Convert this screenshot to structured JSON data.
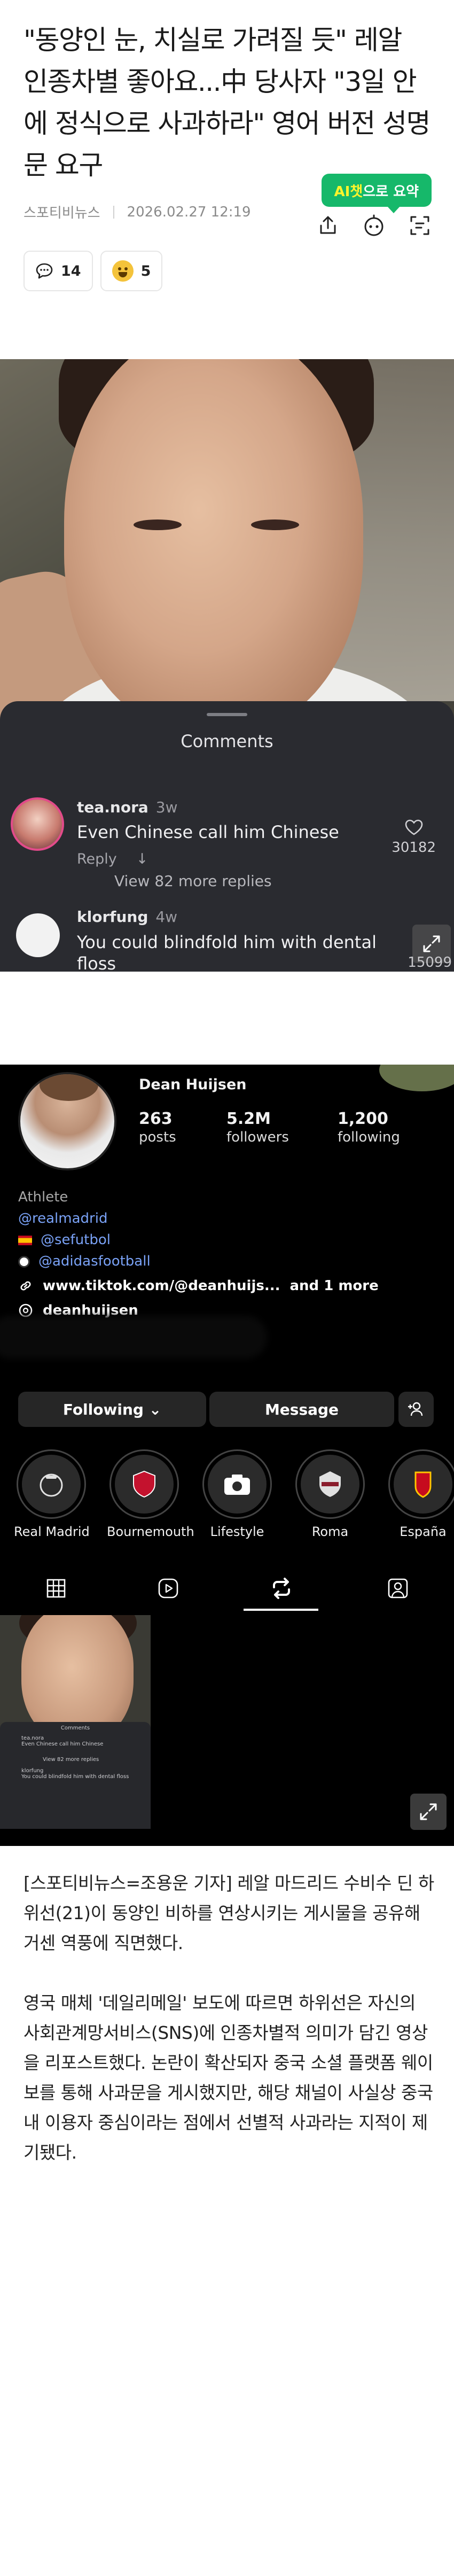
{
  "article": {
    "title": "\"동양인 눈, 치실로 가려질 듯\" 레알 인종차별 좋아요...中 당사자 \"3일 안에 정식으로 사과하라\" 영어 버전 성명문 요구",
    "source": "스포티비뉴스",
    "date": "2026.02.27 12:19",
    "comment_count": "14",
    "reaction_count": "5",
    "ai_summary_prefix": "AI챗",
    "ai_summary_suffix": "으로 요약",
    "paragraphs": [
      "[스포티비뉴스=조용운 기자] 레알 마드리드 수비수 딘 하위선(21)이 동양인 비하를 연상시키는 게시물을 공유해 거센 역풍에 직면했다.",
      "영국 매체 '데일리메일' 보도에 따르면 하위선은 자신의 사회관계망서비스(SNS)에 인종차별적 의미가 담긴 영상을 리포스트했다. 논란이 확산되자 중국 소셜 플랫폼 웨이보를 통해 사과문을 게시했지만, 해당 채널이 사실상 중국 내 이용자 중심이라는 점에서 선별적 사과라는 지적이 제기됐다."
    ]
  },
  "photo1": {
    "sheet_title": "Comments",
    "comment1": {
      "user": "tea.nora",
      "time": "3w",
      "text": "Even Chinese call him Chinese",
      "reply": "Reply",
      "likes": "30182"
    },
    "view_more": "View 82 more replies",
    "comment2": {
      "user": "klorfung",
      "time": "4w",
      "text": "You could blindfold him with dental floss",
      "likes": "15099"
    }
  },
  "photo2": {
    "name": "Dean Huijsen",
    "stats": [
      {
        "value": "263",
        "label": "posts"
      },
      {
        "value": "5.2M",
        "label": "followers"
      },
      {
        "value": "1,200",
        "label": "following"
      }
    ],
    "category": "Athlete",
    "links": [
      "@realmadrid",
      "@sefutbol",
      "@adidasfootball"
    ],
    "website": "www.tiktok.com/@deanhuijs...",
    "website_more": "and 1 more",
    "threads": "deanhuijsen",
    "following_btn": "Following",
    "message_btn": "Message",
    "highlights": [
      "Real Madrid",
      "Bournemouth",
      "Lifestyle",
      "Roma",
      "España"
    ],
    "thumb_text": {
      "title": "Comments",
      "line1": "tea.nora",
      "line2": "Even Chinese call him Chinese",
      "line3": "View 82 more replies",
      "line4": "klorfung",
      "line5": "You could blindfold him with dental floss"
    }
  },
  "colors": {
    "ai_badge": "#16b86a",
    "ai_accent": "#fff42b",
    "link_blue": "#7aa2f6"
  }
}
